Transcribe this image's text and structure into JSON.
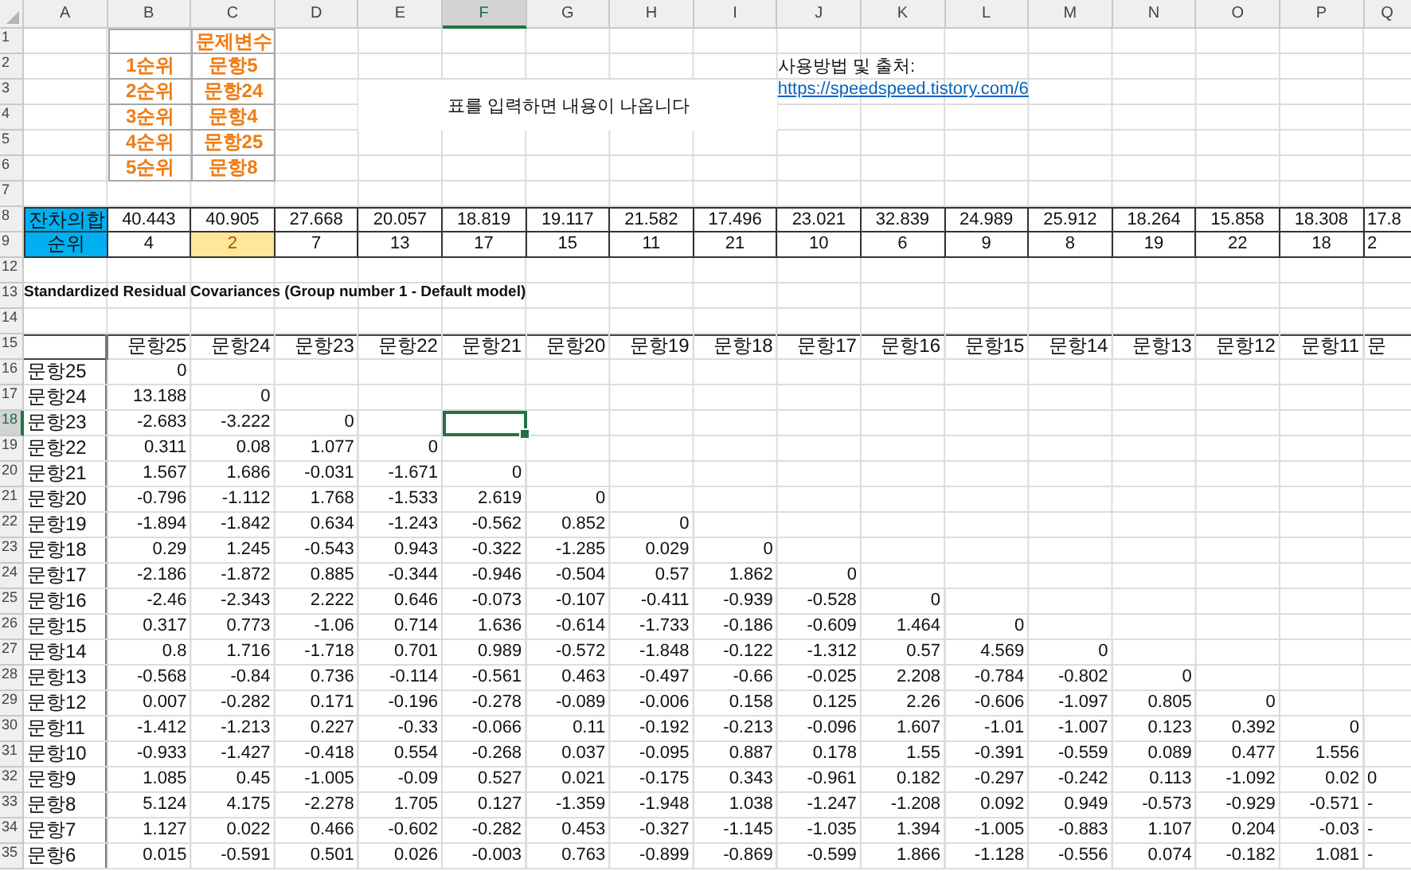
{
  "column_headers": [
    {
      "label": "A",
      "selected": false
    },
    {
      "label": "B",
      "selected": false
    },
    {
      "label": "C",
      "selected": false
    },
    {
      "label": "D",
      "selected": false
    },
    {
      "label": "E",
      "selected": false
    },
    {
      "label": "F",
      "selected": true
    },
    {
      "label": "G",
      "selected": false
    },
    {
      "label": "H",
      "selected": false
    },
    {
      "label": "I",
      "selected": false
    },
    {
      "label": "J",
      "selected": false
    },
    {
      "label": "K",
      "selected": false
    },
    {
      "label": "L",
      "selected": false
    },
    {
      "label": "M",
      "selected": false
    },
    {
      "label": "N",
      "selected": false
    },
    {
      "label": "O",
      "selected": false
    },
    {
      "label": "P",
      "selected": false
    },
    {
      "label": "Q",
      "selected": false
    }
  ],
  "row_numbers": [
    {
      "label": "1",
      "selected": false
    },
    {
      "label": "2",
      "selected": false
    },
    {
      "label": "3",
      "selected": false
    },
    {
      "label": "4",
      "selected": false
    },
    {
      "label": "5",
      "selected": false
    },
    {
      "label": "6",
      "selected": false
    },
    {
      "label": "7",
      "selected": false
    },
    {
      "label": "8",
      "selected": false
    },
    {
      "label": "9",
      "selected": false
    },
    {
      "label": "12",
      "selected": false
    },
    {
      "label": "13",
      "selected": false
    },
    {
      "label": "14",
      "selected": false
    },
    {
      "label": "15",
      "selected": false
    },
    {
      "label": "16",
      "selected": false
    },
    {
      "label": "17",
      "selected": false
    },
    {
      "label": "18",
      "selected": true
    },
    {
      "label": "19",
      "selected": false
    },
    {
      "label": "20",
      "selected": false
    },
    {
      "label": "21",
      "selected": false
    },
    {
      "label": "22",
      "selected": false
    },
    {
      "label": "23",
      "selected": false
    },
    {
      "label": "24",
      "selected": false
    },
    {
      "label": "25",
      "selected": false
    },
    {
      "label": "26",
      "selected": false
    },
    {
      "label": "27",
      "selected": false
    },
    {
      "label": "28",
      "selected": false
    },
    {
      "label": "29",
      "selected": false
    },
    {
      "label": "30",
      "selected": false
    },
    {
      "label": "31",
      "selected": false
    },
    {
      "label": "32",
      "selected": false
    },
    {
      "label": "33",
      "selected": false
    },
    {
      "label": "34",
      "selected": false
    },
    {
      "label": "35",
      "selected": false
    }
  ],
  "top_table": {
    "header": "문제변수",
    "rows": [
      {
        "rank": "1순위",
        "item": "문항5"
      },
      {
        "rank": "2순위",
        "item": "문항24"
      },
      {
        "rank": "3순위",
        "item": "문항4"
      },
      {
        "rank": "4순위",
        "item": "문항25"
      },
      {
        "rank": "5순위",
        "item": "문항8"
      }
    ]
  },
  "notice": "표를 입력하면 내용이 나옵니다",
  "source": {
    "label": "사용방법 및 출처:",
    "link": "https://speedspeed.tistory.com/6"
  },
  "summary": {
    "sum_label": "잔차의합",
    "rank_label": "순위",
    "sums": [
      "40.443",
      "40.905",
      "27.668",
      "20.057",
      "18.819",
      "19.117",
      "21.582",
      "17.496",
      "23.021",
      "32.839",
      "24.989",
      "25.912",
      "18.264",
      "15.858",
      "18.308",
      "17.8"
    ],
    "ranks": [
      {
        "value": "4",
        "highlighted": false
      },
      {
        "value": "2",
        "highlighted": true
      },
      {
        "value": "7",
        "highlighted": false
      },
      {
        "value": "13",
        "highlighted": false
      },
      {
        "value": "17",
        "highlighted": false
      },
      {
        "value": "15",
        "highlighted": false
      },
      {
        "value": "11",
        "highlighted": false
      },
      {
        "value": "21",
        "highlighted": false
      },
      {
        "value": "10",
        "highlighted": false
      },
      {
        "value": "6",
        "highlighted": false
      },
      {
        "value": "9",
        "highlighted": false
      },
      {
        "value": "8",
        "highlighted": false
      },
      {
        "value": "19",
        "highlighted": false
      },
      {
        "value": "22",
        "highlighted": false
      },
      {
        "value": "18",
        "highlighted": false
      },
      {
        "value": "2",
        "highlighted": false
      }
    ]
  },
  "matrix": {
    "title": "Standardized Residual Covariances (Group number 1 - Default model)",
    "columns": [
      "문항25",
      "문항24",
      "문항23",
      "문항22",
      "문항21",
      "문항20",
      "문항19",
      "문항18",
      "문항17",
      "문항16",
      "문항15",
      "문항14",
      "문항13",
      "문항12",
      "문항11",
      "문"
    ],
    "rows": [
      {
        "label": "문항25",
        "values": [
          "0"
        ]
      },
      {
        "label": "문항24",
        "values": [
          "13.188",
          "0"
        ]
      },
      {
        "label": "문항23",
        "values": [
          "-2.683",
          "-3.222",
          "0"
        ]
      },
      {
        "label": "문항22",
        "values": [
          "0.311",
          "0.08",
          "1.077",
          "0"
        ]
      },
      {
        "label": "문항21",
        "values": [
          "1.567",
          "1.686",
          "-0.031",
          "-1.671",
          "0"
        ]
      },
      {
        "label": "문항20",
        "values": [
          "-0.796",
          "-1.112",
          "1.768",
          "-1.533",
          "2.619",
          "0"
        ]
      },
      {
        "label": "문항19",
        "values": [
          "-1.894",
          "-1.842",
          "0.634",
          "-1.243",
          "-0.562",
          "0.852",
          "0"
        ]
      },
      {
        "label": "문항18",
        "values": [
          "0.29",
          "1.245",
          "-0.543",
          "0.943",
          "-0.322",
          "-1.285",
          "0.029",
          "0"
        ]
      },
      {
        "label": "문항17",
        "values": [
          "-2.186",
          "-1.872",
          "0.885",
          "-0.344",
          "-0.946",
          "-0.504",
          "0.57",
          "1.862",
          "0"
        ]
      },
      {
        "label": "문항16",
        "values": [
          "-2.46",
          "-2.343",
          "2.222",
          "0.646",
          "-0.073",
          "-0.107",
          "-0.411",
          "-0.939",
          "-0.528",
          "0"
        ]
      },
      {
        "label": "문항15",
        "values": [
          "0.317",
          "0.773",
          "-1.06",
          "0.714",
          "1.636",
          "-0.614",
          "-1.733",
          "-0.186",
          "-0.609",
          "1.464",
          "0"
        ]
      },
      {
        "label": "문항14",
        "values": [
          "0.8",
          "1.716",
          "-1.718",
          "0.701",
          "0.989",
          "-0.572",
          "-1.848",
          "-0.122",
          "-1.312",
          "0.57",
          "4.569",
          "0"
        ]
      },
      {
        "label": "문항13",
        "values": [
          "-0.568",
          "-0.84",
          "0.736",
          "-0.114",
          "-0.561",
          "0.463",
          "-0.497",
          "-0.66",
          "-0.025",
          "2.208",
          "-0.784",
          "-0.802",
          "0"
        ]
      },
      {
        "label": "문항12",
        "values": [
          "0.007",
          "-0.282",
          "0.171",
          "-0.196",
          "-0.278",
          "-0.089",
          "-0.006",
          "0.158",
          "0.125",
          "2.26",
          "-0.606",
          "-1.097",
          "0.805",
          "0"
        ]
      },
      {
        "label": "문항11",
        "values": [
          "-1.412",
          "-1.213",
          "0.227",
          "-0.33",
          "-0.066",
          "0.11",
          "-0.192",
          "-0.213",
          "-0.096",
          "1.607",
          "-1.01",
          "-1.007",
          "0.123",
          "0.392",
          "0"
        ]
      },
      {
        "label": "문항10",
        "values": [
          "-0.933",
          "-1.427",
          "-0.418",
          "0.554",
          "-0.268",
          "0.037",
          "-0.095",
          "0.887",
          "0.178",
          "1.55",
          "-0.391",
          "-0.559",
          "0.089",
          "0.477",
          "1.556"
        ]
      },
      {
        "label": "문항9",
        "values": [
          "1.085",
          "0.45",
          "-1.005",
          "-0.09",
          "0.527",
          "0.021",
          "-0.175",
          "0.343",
          "-0.961",
          "0.182",
          "-0.297",
          "-0.242",
          "0.113",
          "-1.092",
          "0.02",
          "0"
        ]
      },
      {
        "label": "문항8",
        "values": [
          "5.124",
          "4.175",
          "-2.278",
          "1.705",
          "0.127",
          "-1.359",
          "-1.948",
          "1.038",
          "-1.247",
          "-1.208",
          "0.092",
          "0.949",
          "-0.573",
          "-0.929",
          "-0.571",
          "-"
        ]
      },
      {
        "label": "문항7",
        "values": [
          "1.127",
          "0.022",
          "0.466",
          "-0.602",
          "-0.282",
          "0.453",
          "-0.327",
          "-1.145",
          "-1.035",
          "1.394",
          "-1.005",
          "-0.883",
          "1.107",
          "0.204",
          "-0.03",
          "-"
        ]
      },
      {
        "label": "문항6",
        "values": [
          "0.015",
          "-0.591",
          "0.501",
          "0.026",
          "-0.003",
          "0.763",
          "-0.899",
          "-0.869",
          "-0.599",
          "1.866",
          "-1.128",
          "-0.556",
          "0.074",
          "-0.182",
          "1.081",
          "-"
        ]
      }
    ]
  }
}
